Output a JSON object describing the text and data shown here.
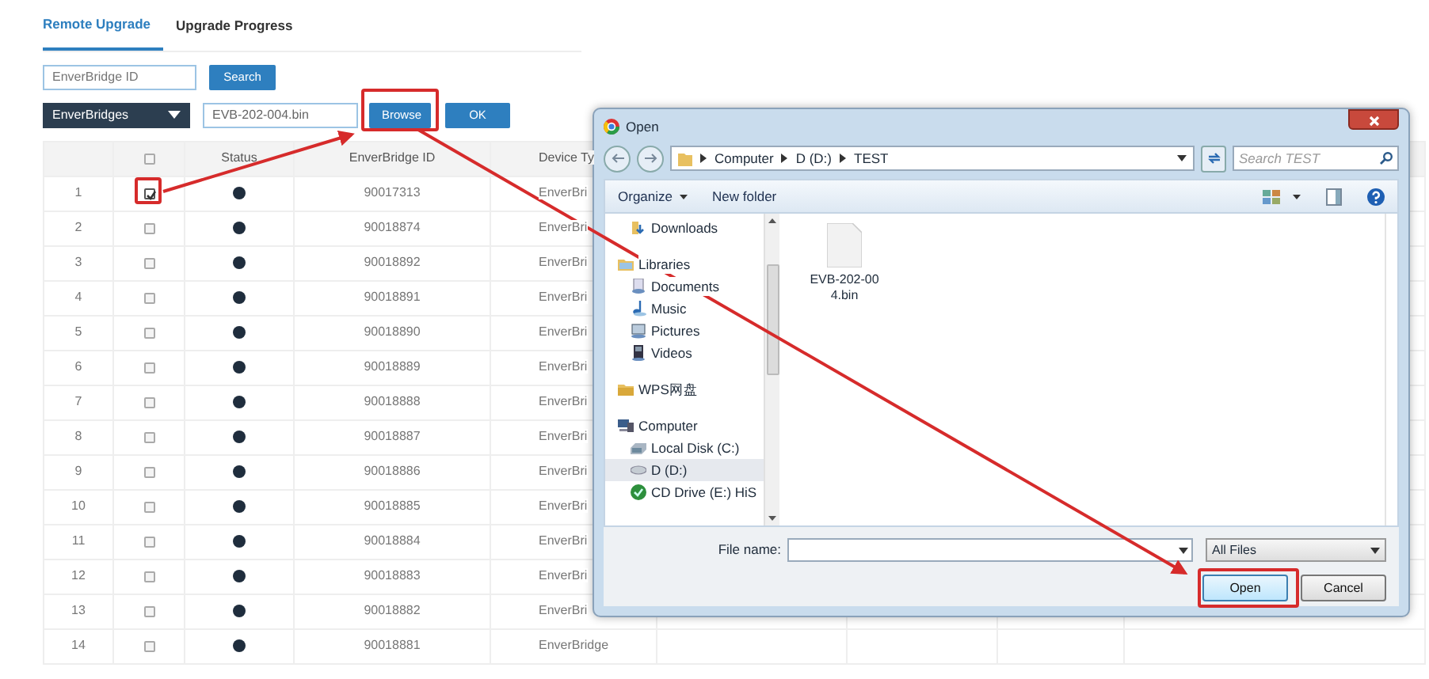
{
  "tabs": [
    {
      "label": "Remote Upgrade",
      "selected": true
    },
    {
      "label": "Upgrade Progress",
      "selected": false
    }
  ],
  "search": {
    "placeholder": "EnverBridge ID",
    "button": "Search"
  },
  "upgrade_bar": {
    "dropdown": "EnverBridges",
    "file": "EVB-202-004.bin",
    "browse": "Browse",
    "ok": "OK"
  },
  "table": {
    "columns": [
      "Status",
      "EnverBridge ID",
      "Device Ty"
    ],
    "header_checked": false,
    "rows": [
      {
        "index": "1",
        "checked": true,
        "id": "90017313",
        "device_type": "EnverBri"
      },
      {
        "index": "2",
        "checked": false,
        "id": "90018874",
        "device_type": "EnverBri"
      },
      {
        "index": "3",
        "checked": false,
        "id": "90018892",
        "device_type": "EnverBri"
      },
      {
        "index": "4",
        "checked": false,
        "id": "90018891",
        "device_type": "EnverBri"
      },
      {
        "index": "5",
        "checked": false,
        "id": "90018890",
        "device_type": "EnverBri"
      },
      {
        "index": "6",
        "checked": false,
        "id": "90018889",
        "device_type": "EnverBri"
      },
      {
        "index": "7",
        "checked": false,
        "id": "90018888",
        "device_type": "EnverBri"
      },
      {
        "index": "8",
        "checked": false,
        "id": "90018887",
        "device_type": "EnverBri"
      },
      {
        "index": "9",
        "checked": false,
        "id": "90018886",
        "device_type": "EnverBri"
      },
      {
        "index": "10",
        "checked": false,
        "id": "90018885",
        "device_type": "EnverBri"
      },
      {
        "index": "11",
        "checked": false,
        "id": "90018884",
        "device_type": "EnverBri"
      },
      {
        "index": "12",
        "checked": false,
        "id": "90018883",
        "device_type": "EnverBri"
      },
      {
        "index": "13",
        "checked": false,
        "id": "90018882",
        "device_type": "EnverBri"
      },
      {
        "index": "14",
        "checked": false,
        "id": "90018881",
        "device_type": "EnverBridge"
      }
    ]
  },
  "dialog": {
    "title": "Open",
    "breadcrumb": [
      "Computer",
      "D (D:)",
      "TEST"
    ],
    "search_placeholder": "Search TEST",
    "toolbar": [
      {
        "label": "Organize",
        "menu": true
      },
      {
        "label": "New folder",
        "menu": false
      }
    ],
    "nav_groups": [
      {
        "items": [
          {
            "label": "Downloads",
            "kind": "download",
            "selected": false
          }
        ]
      },
      {
        "items": [
          {
            "label": "Libraries",
            "kind": "library",
            "selected": false
          },
          {
            "label": "Documents",
            "kind": "document",
            "selected": false
          },
          {
            "label": "Music",
            "kind": "music",
            "selected": false
          },
          {
            "label": "Pictures",
            "kind": "picture",
            "selected": false
          },
          {
            "label": "Videos",
            "kind": "video",
            "selected": false
          }
        ]
      },
      {
        "items": [
          {
            "label": "WPS网盘",
            "kind": "folder",
            "selected": false
          }
        ]
      },
      {
        "items": [
          {
            "label": "Computer",
            "kind": "computer",
            "selected": false
          },
          {
            "label": "Local Disk (C:)",
            "kind": "disk",
            "selected": false
          },
          {
            "label": "D (D:)",
            "kind": "drive",
            "selected": true
          },
          {
            "label": "CD Drive (E:) HiS",
            "kind": "cd",
            "selected": false
          }
        ]
      }
    ],
    "files": [
      {
        "name": "EVB-202-004.bin"
      }
    ],
    "file_name_label": "File name:",
    "file_type": "All Files",
    "buttons": [
      {
        "label": "Open",
        "default": true
      },
      {
        "label": "Cancel",
        "default": false
      }
    ]
  }
}
